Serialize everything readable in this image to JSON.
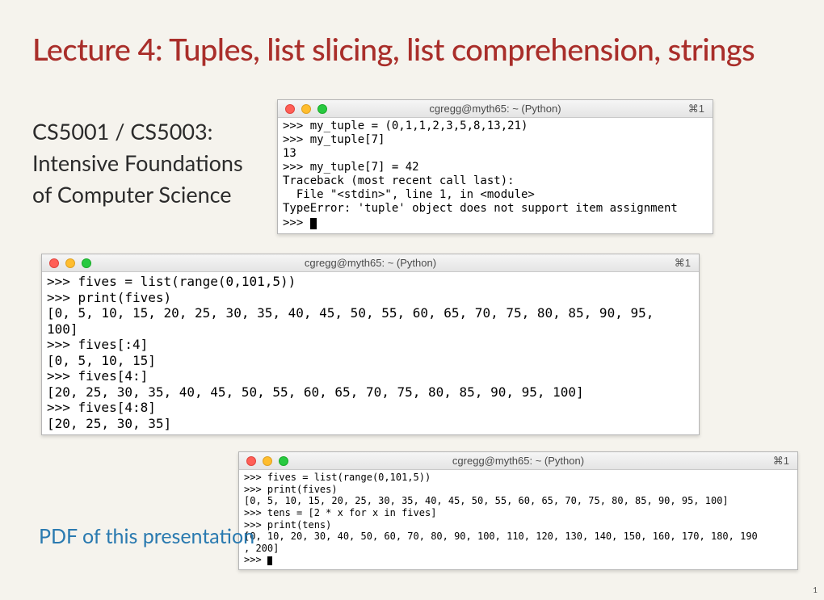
{
  "title": "Lecture 4: Tuples, list slicing, list comprehension, strings",
  "course": "CS5001 / CS5003:\nIntensive Foundations\nof Computer Science",
  "pdf_link": "PDF of this presentation",
  "page_number": "1",
  "terminals": {
    "t1": {
      "title": "cgregg@myth65: ~ (Python)",
      "tab": "⌘1",
      "body": ">>> my_tuple = (0,1,1,2,3,5,8,13,21)\n>>> my_tuple[7]\n13\n>>> my_tuple[7] = 42\nTraceback (most recent call last):\n  File \"<stdin>\", line 1, in <module>\nTypeError: 'tuple' object does not support item assignment\n>>> ",
      "trailing_cursor": true
    },
    "t2": {
      "title": "cgregg@myth65: ~ (Python)",
      "tab": "⌘1",
      "body": ">>> fives = list(range(0,101,5))\n>>> print(fives)\n[0, 5, 10, 15, 20, 25, 30, 35, 40, 45, 50, 55, 60, 65, 70, 75, 80, 85, 90, 95,\n100]\n>>> fives[:4]\n[0, 5, 10, 15]\n>>> fives[4:]\n[20, 25, 30, 35, 40, 45, 50, 55, 60, 65, 70, 75, 80, 85, 90, 95, 100]\n>>> fives[4:8]\n[20, 25, 30, 35]",
      "trailing_cursor": false
    },
    "t3": {
      "title": "cgregg@myth65: ~ (Python)",
      "tab": "⌘1",
      "body": ">>> fives = list(range(0,101,5))\n>>> print(fives)\n[0, 5, 10, 15, 20, 25, 30, 35, 40, 45, 50, 55, 60, 65, 70, 75, 80, 85, 90, 95, 100]\n>>> tens = [2 * x for x in fives]\n>>> print(tens)\n[0, 10, 20, 30, 40, 50, 60, 70, 80, 90, 100, 110, 120, 130, 140, 150, 160, 170, 180, 190\n, 200]\n>>> ",
      "trailing_cursor": true
    }
  }
}
